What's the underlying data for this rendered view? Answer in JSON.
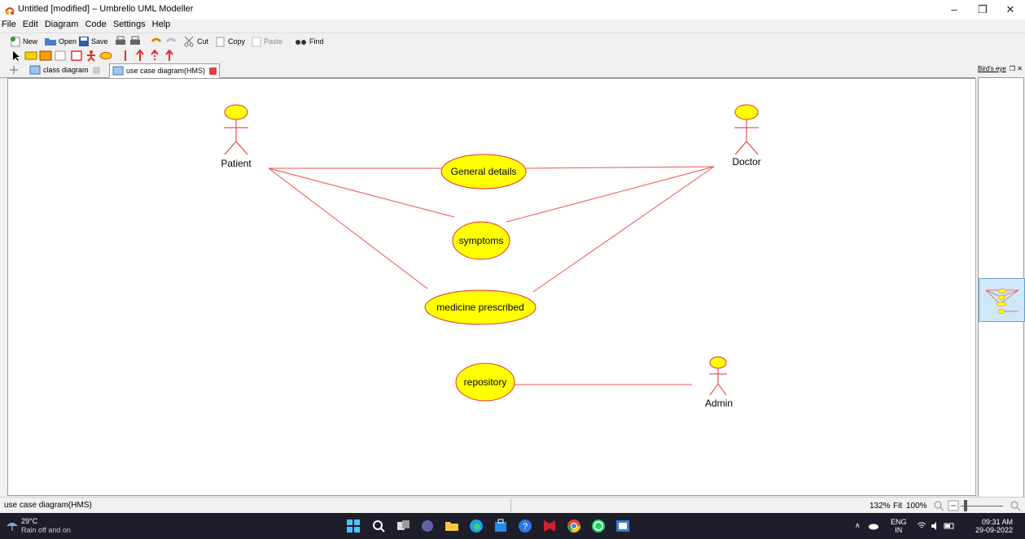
{
  "window": {
    "title": "Untitled [modified] – Umbrello UML Modeller",
    "controls": [
      "minimize-icon",
      "restore-icon",
      "close-icon"
    ]
  },
  "menu": [
    "File",
    "Edit",
    "Diagram",
    "Code",
    "Settings",
    "Help"
  ],
  "toolbar": {
    "new": "New",
    "open": "Open",
    "save": "Save",
    "cut": "Cut",
    "copy": "Copy",
    "paste": "Paste",
    "find": "Find"
  },
  "tabs": [
    {
      "label": "class diagram",
      "active": false
    },
    {
      "label": "use case diagram(HMS)",
      "active": true
    }
  ],
  "diagram": {
    "actors": {
      "patient": "Patient",
      "doctor": "Doctor",
      "admin": "Admin"
    },
    "usecases": {
      "general": "General details",
      "symptoms": "symptoms",
      "medicine": "medicine prescribed",
      "repository": "repository"
    },
    "colors": {
      "fill": "#ffff00",
      "stroke": "#e53030",
      "line": "#f05050"
    }
  },
  "birds_eye": {
    "title": "Bird's eye"
  },
  "status": {
    "diagram_name": "use case diagram(HMS)",
    "zoom": "132%",
    "fit": "Fit",
    "hundred": "100%"
  },
  "taskbar": {
    "temperature": "29°C",
    "weather": "Rain off and on",
    "lang": "ENG",
    "region": "IN",
    "time": "09:31 AM",
    "date": "29-09-2022"
  }
}
